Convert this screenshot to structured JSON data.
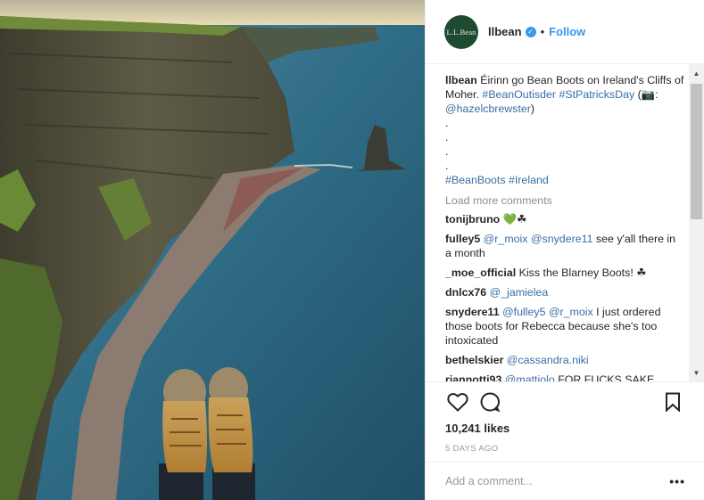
{
  "post": {
    "username": "llbean",
    "avatar_text": "L.L.Bean",
    "separator": "•",
    "follow_label": "Follow",
    "caption": {
      "username": "llbean",
      "text": "Éirinn go Bean Boots on Ireland's Cliffs of Moher.",
      "hashtag_1": "#BeanOutisder",
      "hashtag_2": "#StPatricksDay",
      "photo_credit_prefix": "(📷: ",
      "photo_credit_user": "@hazelcbrewster",
      "photo_credit_suffix": ")",
      "dot": ".",
      "hashtag_3": "#BeanBoots",
      "hashtag_4": "#Ireland"
    },
    "load_more": "Load more comments",
    "comments": [
      {
        "user": "tonijbruno",
        "text": "💚☘"
      },
      {
        "user": "fulley5",
        "mention_1": "@r_moix",
        "mention_2": "@snydere11",
        "text": " see y'all there in a month"
      },
      {
        "user": "_moe_official",
        "text": "Kiss the Blarney Boots! ☘"
      },
      {
        "user": "dnlcx76",
        "mention_1": "@_jamielea"
      },
      {
        "user": "snydere11",
        "mention_1": "@fulley5",
        "mention_2": "@r_moix",
        "text": " I just ordered those boots for Rebecca because she's too intoxicated"
      },
      {
        "user": "bethelskier",
        "mention_1": "@cassandra.niki"
      },
      {
        "user": "riannotti93",
        "mention_1": "@mattiolo",
        "text": " FOR FUCKS SAKE"
      }
    ],
    "likes": "10,241 likes",
    "posted_ago": "5 DAYS AGO",
    "add_comment_placeholder": "Add a comment...",
    "more_options": "•••",
    "scroll_up": "▲",
    "scroll_down": "▼"
  },
  "icons": {
    "like": "heart-icon",
    "comment": "comment-bubble-icon",
    "save": "bookmark-icon",
    "verified": "verified-badge-icon"
  },
  "colors": {
    "link": "#3897f0",
    "hashtag": "#3a6ea5",
    "muted": "#999999",
    "avatar_bg": "#1f4a2f"
  }
}
